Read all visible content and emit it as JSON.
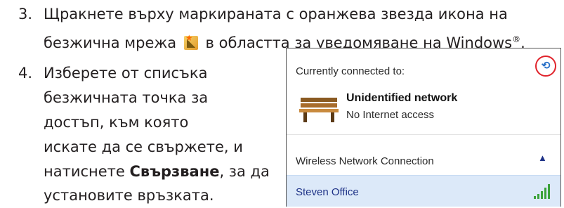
{
  "step3": {
    "number": "3.",
    "line1": "Щракнете върху маркираната с оранжева звезда икона на",
    "line2_before": "безжична мрежа",
    "line2_after": "в областта за уведомяване на Windows",
    "reg": "®",
    "period": ".",
    "icon": "wireless-network-star-icon"
  },
  "step4": {
    "number": "4.",
    "lines": [
      "Изберете от списъка",
      "безжичната точка за",
      "достъп, към която",
      "искате да се свържете, и"
    ],
    "line5_before": "натиснете ",
    "line5_bold": "Свързване",
    "line5_after": ", за да",
    "line6": "установите връзката."
  },
  "popup": {
    "currently_connected": "Currently connected to:",
    "network_name": "Unidentified network",
    "network_status": "No Internet access",
    "section_label": "Wireless Network Connection",
    "wifi_item": "Steven Office",
    "refresh_icon": "refresh-icon",
    "chevron_icon": "chevron-up-icon",
    "signal_icon": "signal-strength-icon"
  },
  "colors": {
    "highlight_circle": "#e0232b",
    "link_blue": "#1e3287",
    "selected_row": "#dce9f9"
  }
}
